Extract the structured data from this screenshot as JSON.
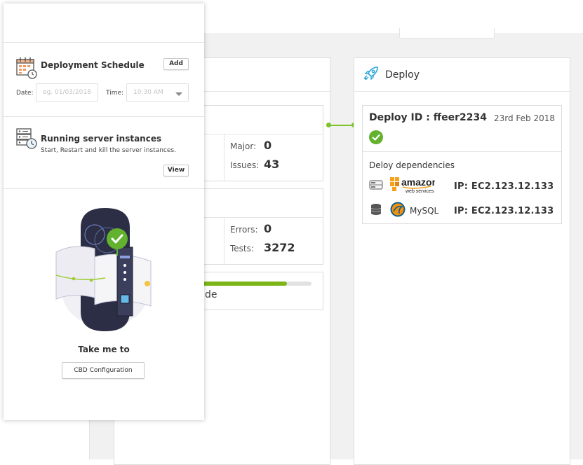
{
  "schedule": {
    "title": "Deployment Schedule",
    "add_label": "Add",
    "date_label": "Date:",
    "date_placeholder": "eg. 01/03/2018",
    "time_label": "Time:",
    "time_value": "10:30 AM"
  },
  "running": {
    "title": "Running server instances",
    "subtitle": "Start, Restart and kill the server instances.",
    "view_label": "View"
  },
  "cta": {
    "text": "Take me to",
    "button_label": "CBD Configuration"
  },
  "stats": {
    "card1": {
      "major_label": "Major:",
      "major_value": "0",
      "issues_label": "Issues:",
      "issues_value": "43"
    },
    "card2": {
      "errors_label": "Errors:",
      "errors_value": "0",
      "tests_label": "Tests:",
      "tests_value": "3272"
    },
    "card3": {
      "progress_fraction": 0.78,
      "text_fragment": "de"
    }
  },
  "deploy": {
    "title": "Deploy",
    "id_label": "Deploy ID : ffeer2234",
    "date": "23rd Feb 2018",
    "deps_title": "Deloy dependencies",
    "deps": [
      {
        "name": "amazon web services",
        "ip": "IP: EC2.123.12.133"
      },
      {
        "name": "MySQL",
        "ip": "IP: EC2.123.12.133"
      }
    ]
  },
  "colors": {
    "accent_green": "#62b22f",
    "deploy_icon_blue": "#2aa5d8"
  }
}
